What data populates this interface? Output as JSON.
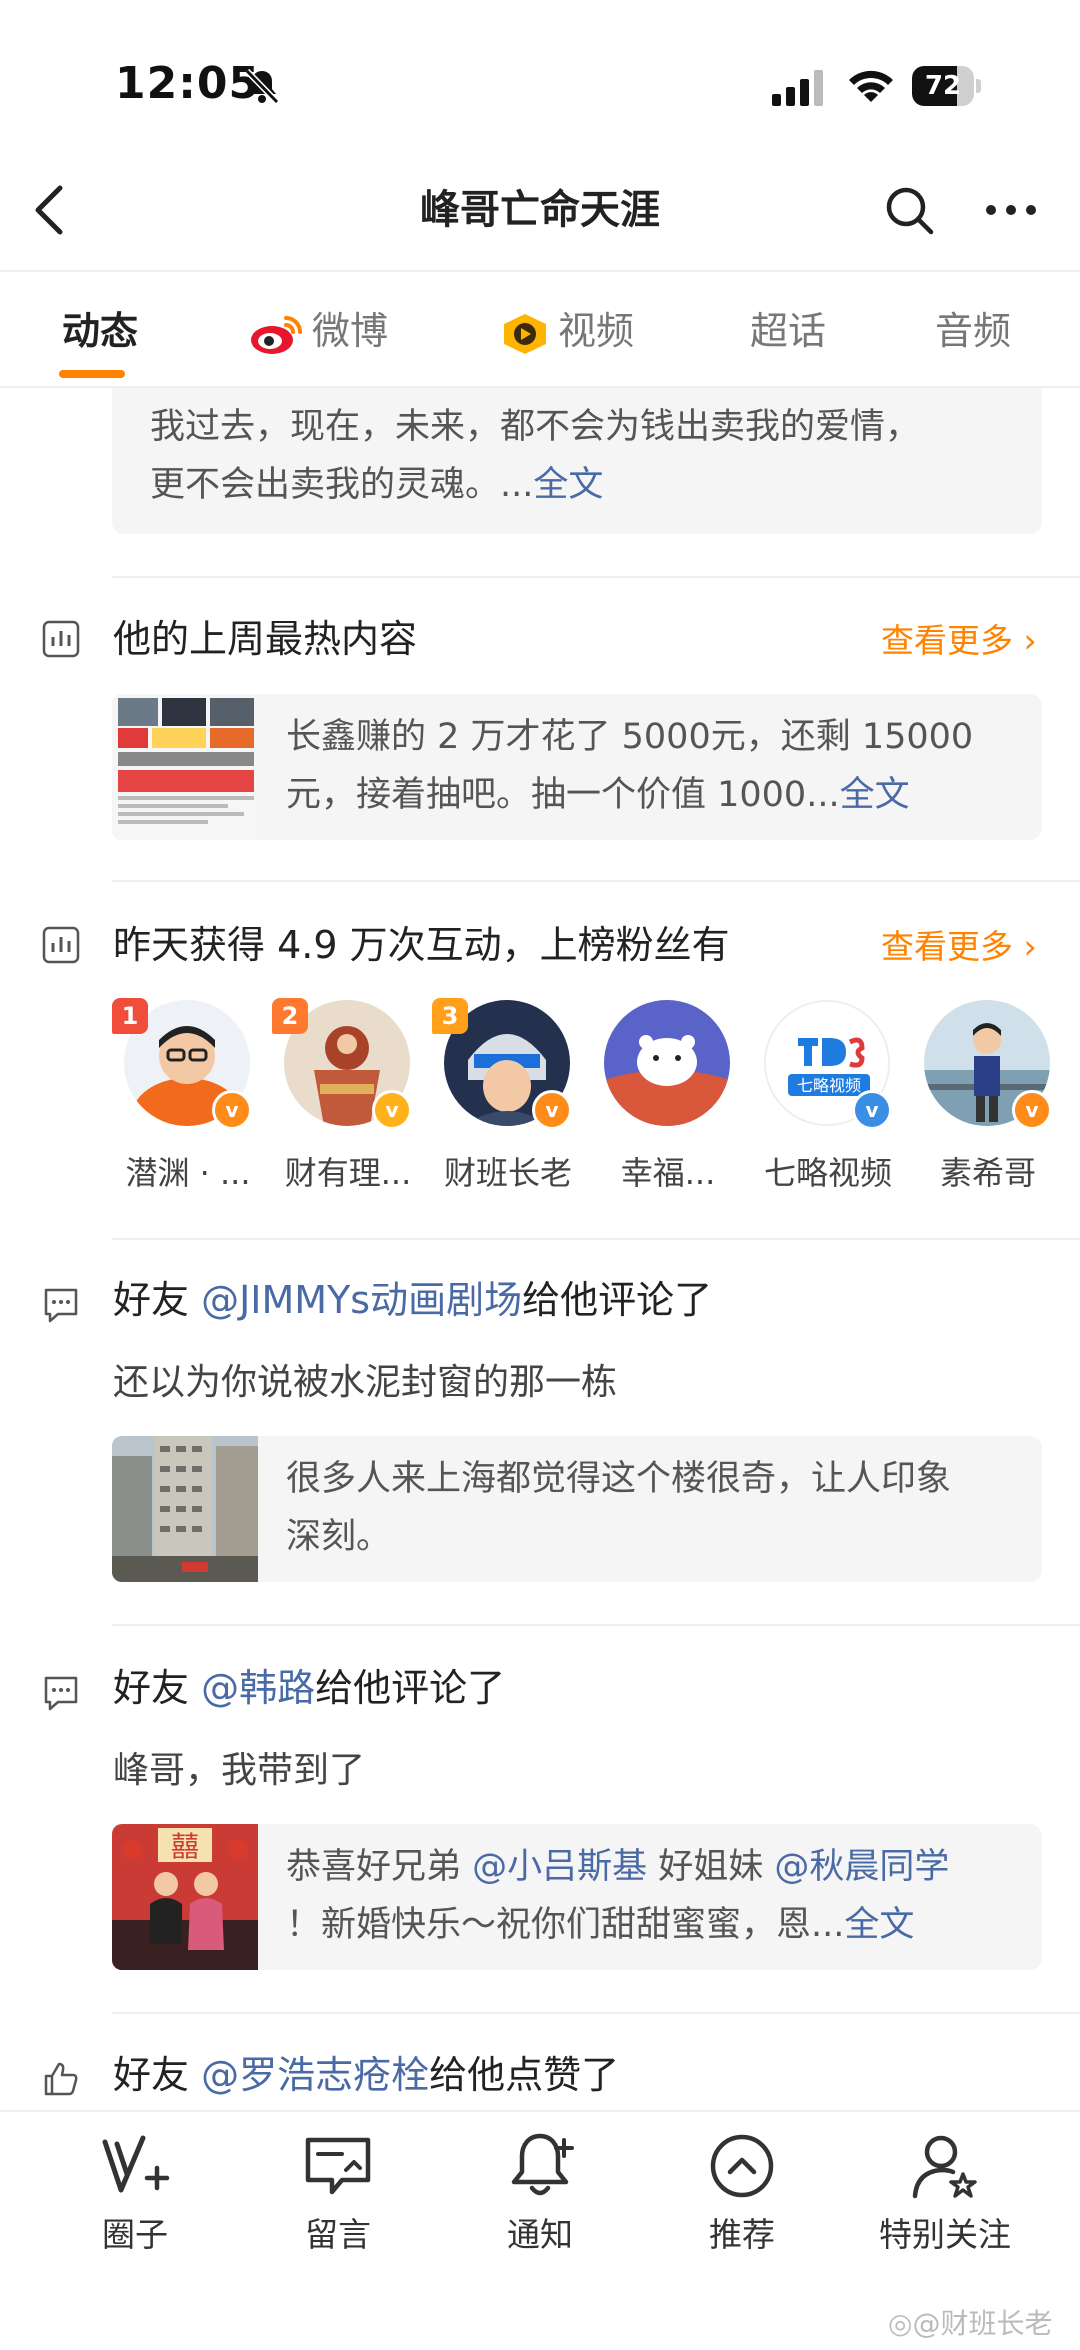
{
  "status_bar": {
    "time": "12:05",
    "battery_level": "72"
  },
  "nav": {
    "title": "峰哥亡命天涯"
  },
  "tabs": [
    {
      "label": "动态",
      "active": true
    },
    {
      "label": "微博",
      "icon": "weibo-icon"
    },
    {
      "label": "视频",
      "icon": "video-icon"
    },
    {
      "label": "超话"
    },
    {
      "label": "音频"
    }
  ],
  "top_card": {
    "line1": "我过去，现在，未来，都不会为钱出卖我的爱情，",
    "line2": "更不会出卖我的灵魂。...",
    "more": "全文"
  },
  "hot_week": {
    "title": "他的上周最热内容",
    "more": "查看更多",
    "card": {
      "line1": "长鑫赚的 2 万才花了 5000元，还剩 15000",
      "line2": "元，接着抽吧。抽一个价值 1000...",
      "more": "全文"
    }
  },
  "fans": {
    "title": "昨天获得 4.9 万次互动，上榜粉丝有",
    "more": "查看更多",
    "items": [
      {
        "rank": "1",
        "name": "潜渊 · ...",
        "rank_color": "#f04e3a",
        "verified_color": "#ff8b1a"
      },
      {
        "rank": "2",
        "name": "财有理...",
        "rank_color": "#ff7a2e",
        "verified_color": "#ffb21a"
      },
      {
        "rank": "3",
        "name": "财班长老",
        "rank_color": "#ff9f1a",
        "verified_color": "#ff8b1a"
      },
      {
        "rank": "",
        "name": "幸福...",
        "verified_color": ""
      },
      {
        "rank": "",
        "name": "七略视频",
        "verified_color": "#3a8ee6"
      },
      {
        "rank": "",
        "name": "素希哥",
        "verified_color": "#ff8b1a"
      }
    ]
  },
  "comment1": {
    "prefix": "好友 ",
    "user": "@JIMMYs动画剧场",
    "suffix": "给他评论了",
    "text": "还以为你说被水泥封窗的那一栋",
    "card_line1": "很多人来上海都觉得这个楼很奇，让人印象",
    "card_line2": "深刻。"
  },
  "comment2": {
    "prefix": "好友 ",
    "user": "@韩路",
    "suffix": "给他评论了",
    "text": "峰哥，我带到了",
    "card_pre": "恭喜好兄弟 ",
    "card_user1": "@小吕斯基",
    "card_mid": " 好姐妹 ",
    "card_user2": "@秋晨同学",
    "card_line2": "！新婚快乐～祝你们甜甜蜜蜜，恩...",
    "card_more": "全文"
  },
  "like": {
    "prefix": "好友 ",
    "user": "@罗浩志疮栓",
    "suffix": "给他点赞了"
  },
  "bottom_bar": [
    {
      "label": "圈子",
      "icon": "circle-icon"
    },
    {
      "label": "留言",
      "icon": "message-icon"
    },
    {
      "label": "通知",
      "icon": "bell-plus-icon"
    },
    {
      "label": "推荐",
      "icon": "recommend-icon"
    },
    {
      "label": "特别关注",
      "icon": "special-follow-icon"
    }
  ],
  "watermark": "@财班长老",
  "colors": {
    "accent": "#ff8200",
    "link": "#4a6aa5"
  }
}
